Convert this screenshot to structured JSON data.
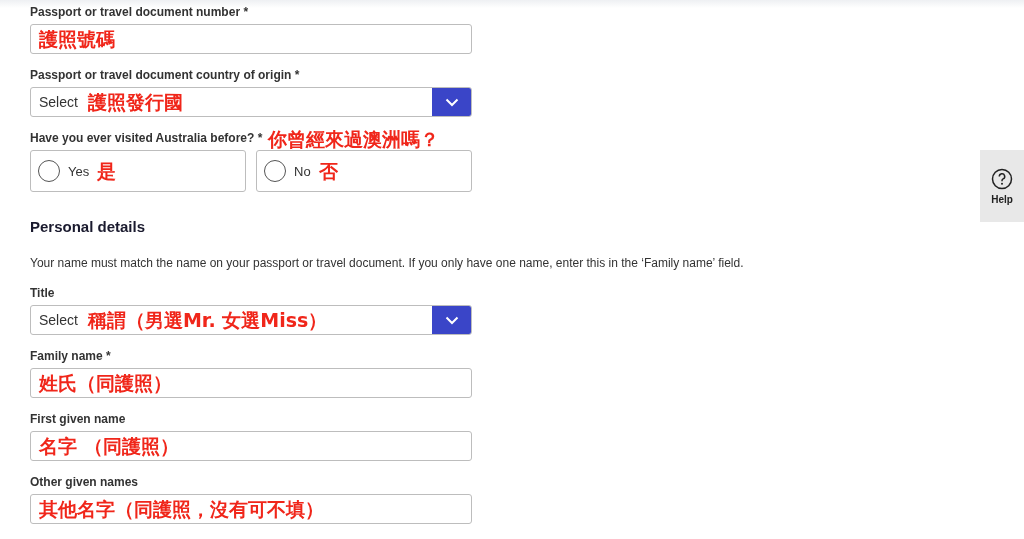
{
  "form": {
    "items": [
      {
        "kind": "text",
        "label": "Passport or travel document number *",
        "annotation": "護照號碼"
      },
      {
        "kind": "select",
        "label": "Passport or travel document country of origin *",
        "value": "Select",
        "annotation": "護照發行國"
      },
      {
        "kind": "radio",
        "label": "Have you ever visited Australia before? *",
        "annotation": "你曾經來過澳洲嗎？",
        "options": [
          {
            "label": "Yes",
            "annotation": "是",
            "selected": false
          },
          {
            "label": "No",
            "annotation": "否",
            "selected": false
          }
        ]
      },
      {
        "kind": "heading",
        "text": "Personal details"
      },
      {
        "kind": "paragraph",
        "text": "Your name must match the name on your passport or travel document. If you only have one name, enter this in the ‘Family name’ field."
      },
      {
        "kind": "select",
        "label": "Title",
        "value": "Select",
        "annotation": "稱謂（男選Mr. 女選Miss）"
      },
      {
        "kind": "text",
        "label": "Family name *",
        "annotation": "姓氏（同護照）"
      },
      {
        "kind": "text",
        "label": "First given name",
        "annotation": "名字 （同護照）"
      },
      {
        "kind": "text",
        "label": "Other given names",
        "annotation": "其他名字（同護照，沒有可不填）"
      }
    ]
  },
  "help": {
    "label": "Help"
  }
}
